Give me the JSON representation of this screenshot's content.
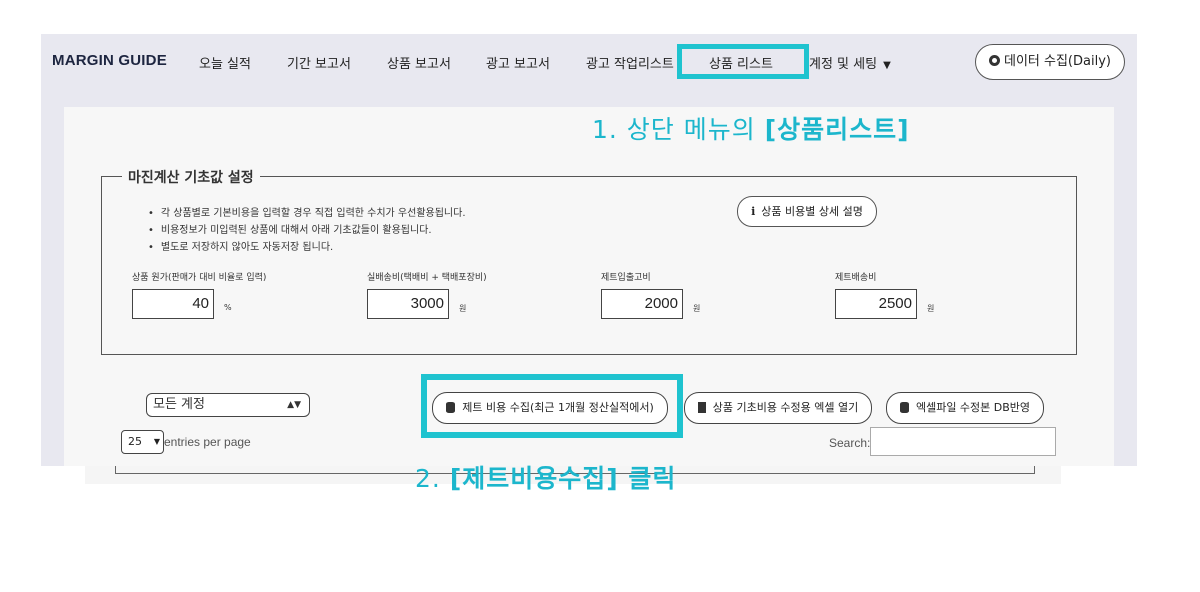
{
  "nav": {
    "logo": "MARGIN GUIDE",
    "items": [
      "오늘 실적",
      "기간 보고서",
      "상품 보고서",
      "광고 보고서",
      "광고 작업리스트",
      "상품 리스트",
      "계정 및 세팅"
    ],
    "data_button": "데이터 수집(Daily)"
  },
  "instructions": {
    "step1_prefix": "1. 상단 메뉴의 ",
    "step1_bold": "[상품리스트]",
    "step2_prefix": "2. ",
    "step2_bold": "[제트비용수집]",
    "step2_suffix": " 클릭"
  },
  "settings": {
    "legend": "마진계산 기초값 설정",
    "bullets": [
      "각 상품별로 기본비용을 입력할 경우 직접 입력한 수치가 우선활용됩니다.",
      "비용정보가 미입력된 상품에 대해서 아래 기초값들이 활용됩니다.",
      "별도로 저장하지 않아도 자동저장 됩니다."
    ],
    "info_button": "상품 비용별 상세 설명",
    "fields": [
      {
        "label": "상품 원가(판매가 대비 비율로 입력)",
        "value": "40",
        "unit": "%"
      },
      {
        "label": "실배송비(택배비 + 택배포장비)",
        "value": "3000",
        "unit": "원"
      },
      {
        "label": "제트입출고비",
        "value": "2000",
        "unit": "원"
      },
      {
        "label": "제트배송비",
        "value": "2500",
        "unit": "원"
      }
    ]
  },
  "actions": {
    "account_select": "모든 계정",
    "collect_button": "제트 비용 수집(최근 1개월 정산실적에서)",
    "excel_open_button": "상품 기초비용 수정용 엑셀 열기",
    "db_apply_button": "엑셀파일 수정본 DB반영",
    "per_page_value": "25",
    "per_page_label": "entries per page",
    "search_label": "Search:"
  },
  "colors": {
    "highlight": "#1fc3cf",
    "instruction_text": "#1cb6cc"
  }
}
